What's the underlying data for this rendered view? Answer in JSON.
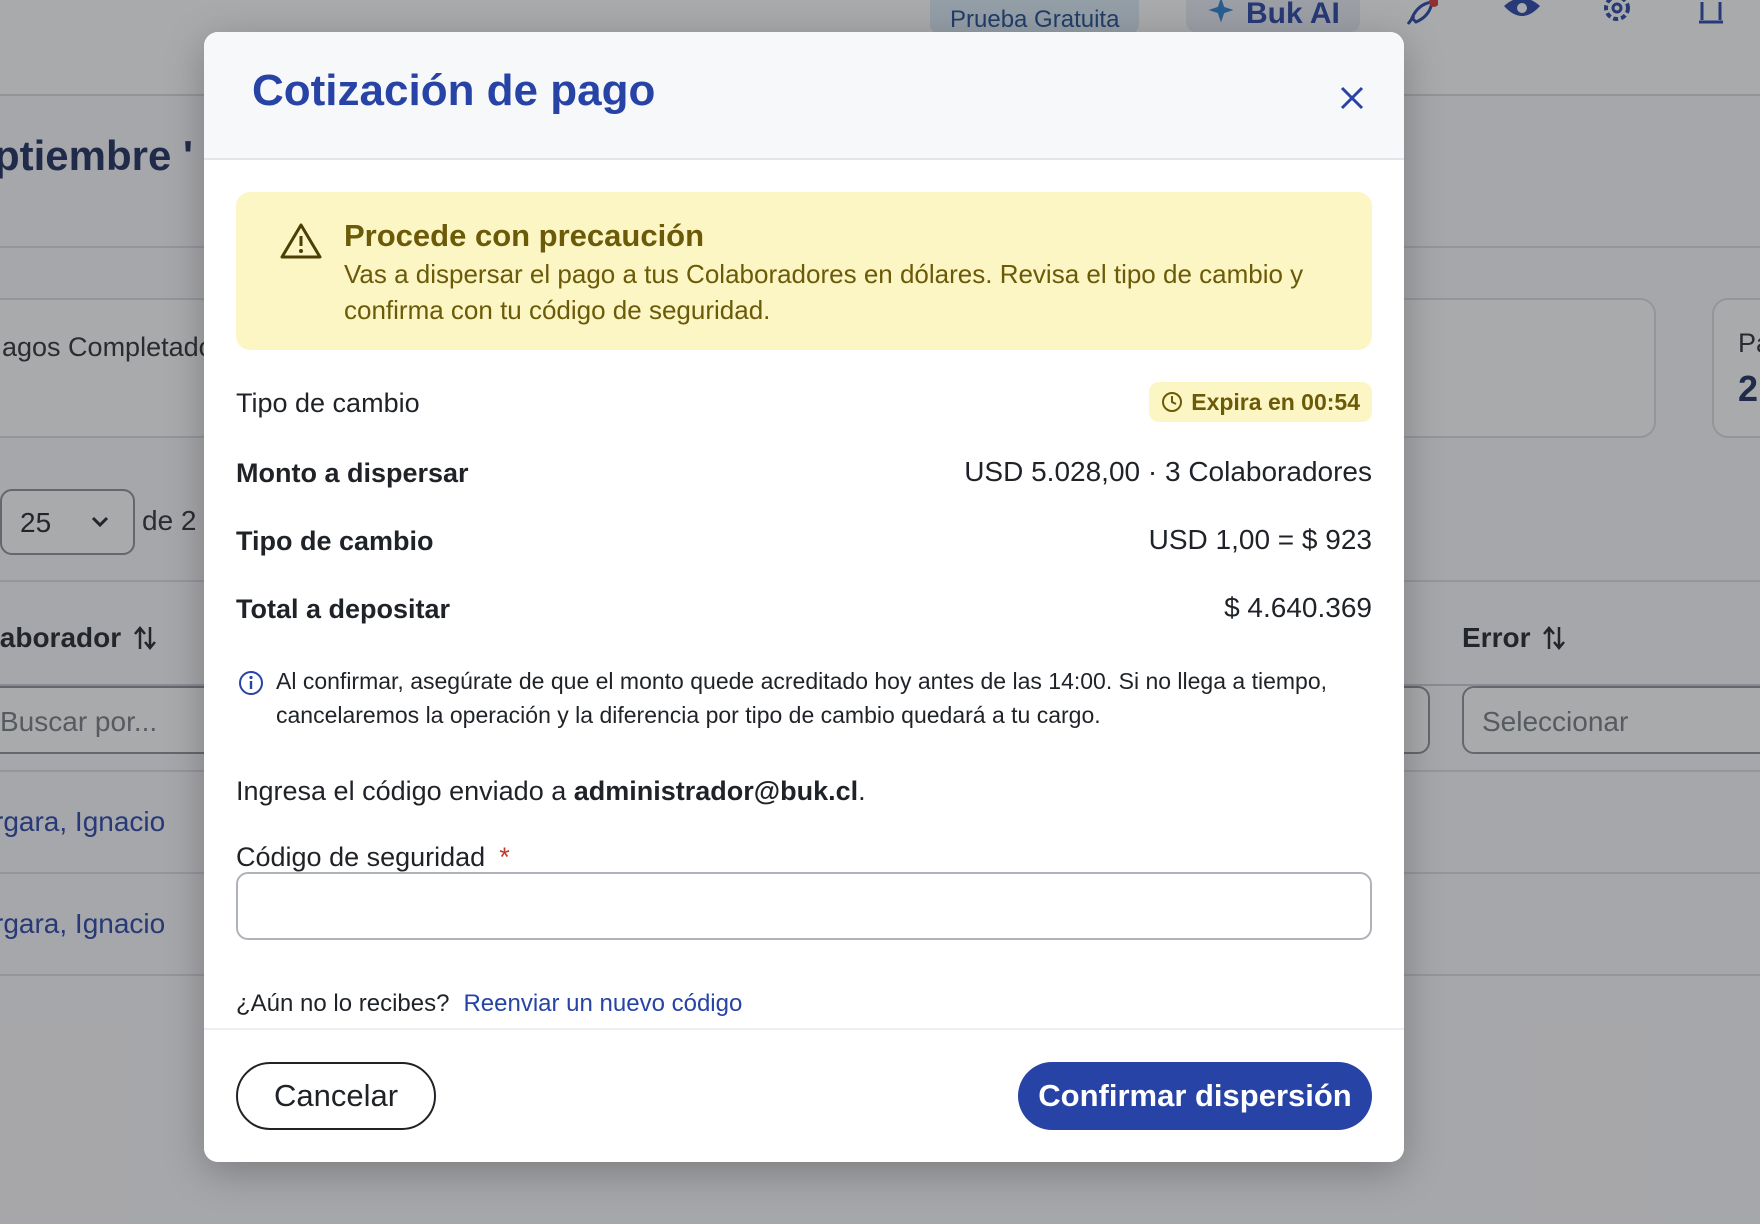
{
  "background": {
    "topbar": {
      "trial_label": "Prueba Gratuita",
      "ai_label": "Buk AI"
    },
    "page_title_fragment": "ptiembre '",
    "stats": {
      "card1_label": "agos Completado",
      "card3_label": "Pa",
      "card3_value": "2"
    },
    "pager": {
      "page_size": "25",
      "of_label": "de 2"
    },
    "table": {
      "col_collaborator": "laborador",
      "col_error": "Error",
      "search_placeholder": "Buscar por...",
      "error_placeholder": "Seleccionar",
      "rows": [
        "rgara, Ignacio",
        "rgara, Ignacio"
      ]
    }
  },
  "modal": {
    "title": "Cotización de pago",
    "alert": {
      "title": "Procede con precaución",
      "text": "Vas a dispersar el pago a tus Colaboradores en dólares. Revisa el tipo de cambio y confirma con tu código de seguridad."
    },
    "exchange": {
      "section_label": "Tipo de cambio",
      "expires_label": "Expira en 00:54"
    },
    "summary": [
      {
        "label": "Monto a dispersar",
        "value": "USD 5.028,00 · 3 Colaboradores"
      },
      {
        "label": "Tipo de cambio",
        "value": "USD 1,00 = $ 923"
      },
      {
        "label": "Total a depositar",
        "value": "$ 4.640.369"
      }
    ],
    "info_text": "Al confirmar, asegúrate de que el monto quede acreditado hoy antes de las 14:00. Si no llega a tiempo, cancelaremos la operación y la diferencia por tipo de cambio quedará a tu cargo.",
    "code_sent_prefix": "Ingresa el código enviado a ",
    "code_sent_email": "administrador@buk.cl",
    "code_sent_suffix": ".",
    "security_code": {
      "label": "Código de seguridad",
      "required_mark": "*",
      "value": ""
    },
    "resend": {
      "question": "¿Aún no lo recibes?",
      "link": "Reenviar un nuevo código"
    },
    "footer": {
      "cancel_label": "Cancelar",
      "confirm_label": "Confirmar dispersión"
    }
  },
  "colors": {
    "primary": "#2743a6",
    "warning_bg": "#fcf6c5",
    "warning_text": "#6b5a08"
  }
}
